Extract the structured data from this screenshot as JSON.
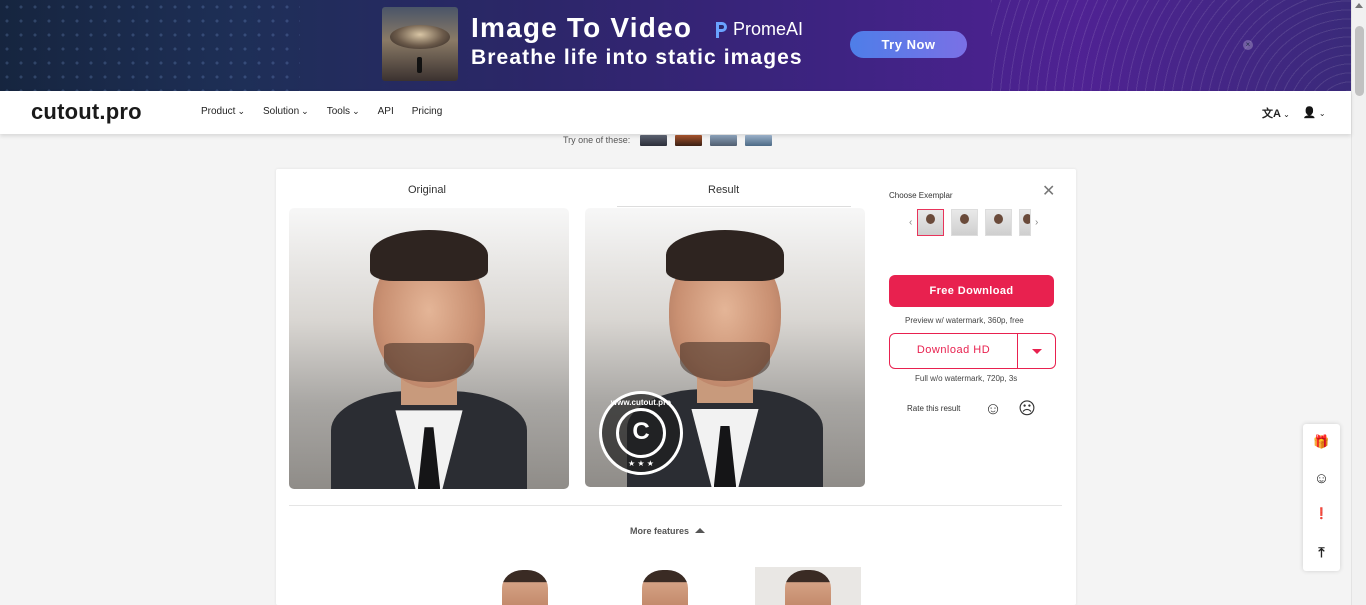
{
  "banner": {
    "title": "Image To Video",
    "brand": "PromeAI",
    "subtitle": "Breathe life into static images",
    "cta": "Try Now",
    "close": "×"
  },
  "nav": {
    "logo": "cutout.pro",
    "menu": [
      {
        "label": "Product",
        "caret": "⌄"
      },
      {
        "label": "Solution",
        "caret": "⌄"
      },
      {
        "label": "Tools",
        "caret": "⌄"
      },
      {
        "label": "API",
        "caret": ""
      },
      {
        "label": "Pricing",
        "caret": ""
      }
    ],
    "lang_icon": "文A",
    "user_icon": "👤"
  },
  "try_one": "Try one of these:",
  "panel": {
    "original_label": "Original",
    "result_label": "Result",
    "watermark_url": "www.cutout.pro",
    "watermark_letter": "C",
    "watermark_stars": "★ ★ ★",
    "choose_exemplar": "Choose Exemplar",
    "free_download": "Free Download",
    "free_hint": "Preview w/ watermark, 360p, free",
    "download_hd": "Download HD",
    "hd_hint": "Full w/o watermark, 720p, 3s",
    "rate": "Rate this result",
    "close": "✕",
    "more_features": "More features"
  },
  "floatbar": {
    "icons": [
      "🎁",
      "☺",
      "❗",
      "⤒"
    ]
  },
  "colors": {
    "accent": "#e8214f",
    "banner_button": "#5b79e8"
  }
}
